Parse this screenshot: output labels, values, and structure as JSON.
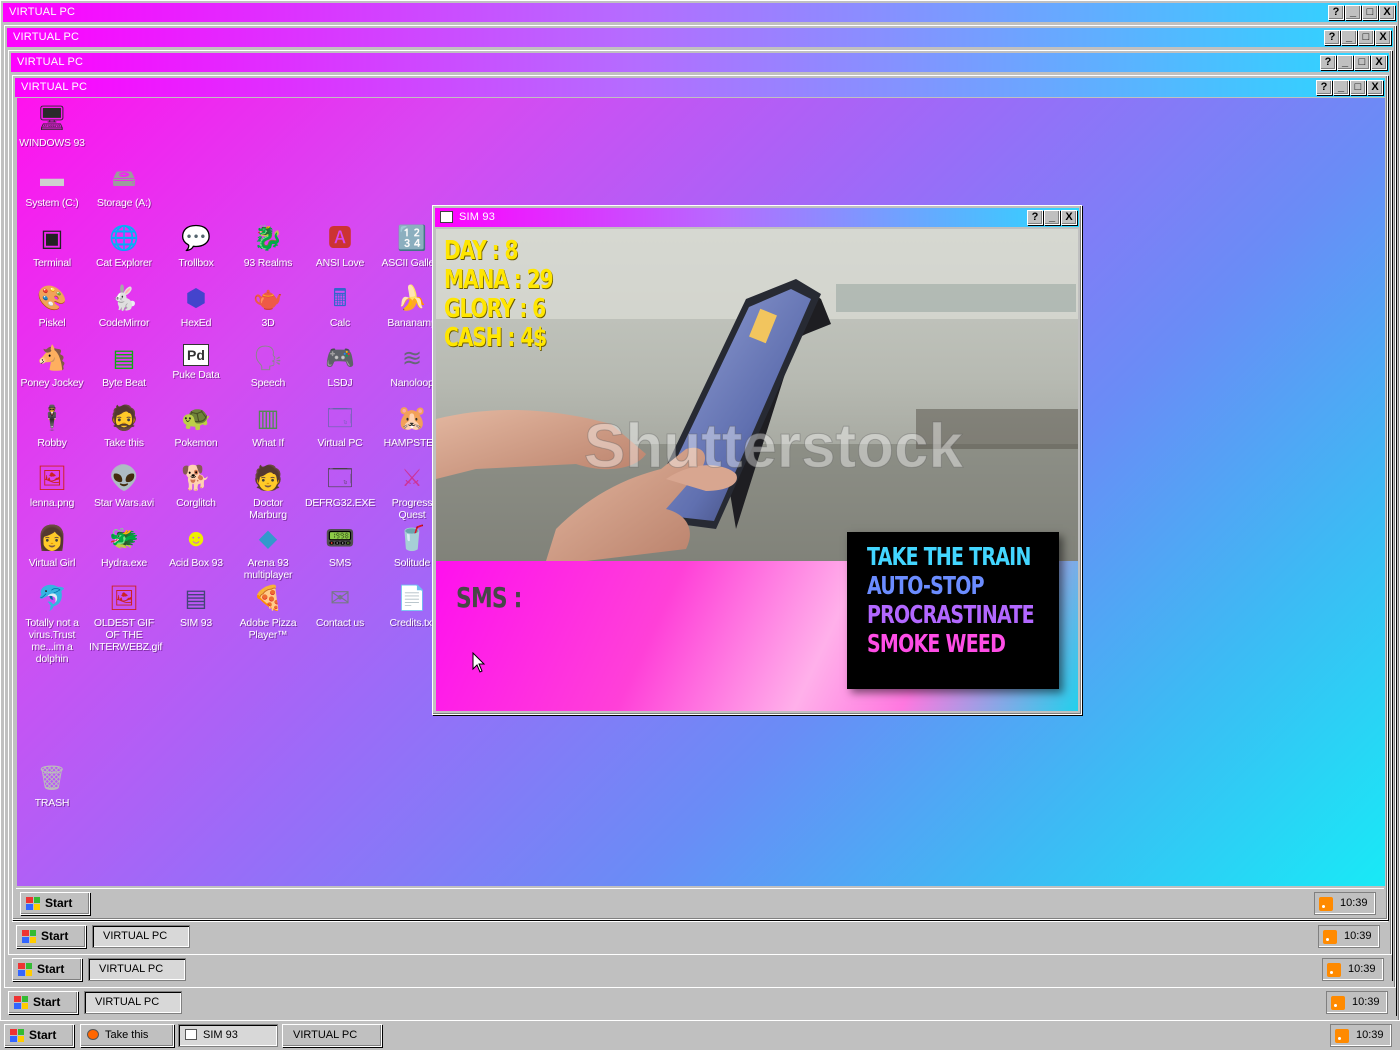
{
  "window_title": "VIRTUAL PC",
  "title_buttons": [
    "?",
    "_",
    "□",
    "X"
  ],
  "colors": {
    "title_gradient": [
      "#ff00ff",
      "#b56cff",
      "#2ad8ff"
    ],
    "stats": "#ffe600"
  },
  "desktop": {
    "icons": [
      {
        "label": "WINDOWS 93",
        "icon": "computer-icon",
        "glyph": "🖥"
      },
      {
        "label": "System (C:)",
        "icon": "hard-drive-icon",
        "glyph": "▬"
      },
      {
        "label": "Storage (A:)",
        "icon": "floppy-drive-icon",
        "glyph": "🖴"
      },
      {
        "label": "Terminal",
        "icon": "terminal-icon",
        "glyph": "▣"
      },
      {
        "label": "Cat Explorer",
        "icon": "globe-cat-icon",
        "glyph": "🌐"
      },
      {
        "label": "Trollbox",
        "icon": "trollbox-icon",
        "glyph": "💬"
      },
      {
        "label": "93 Realms",
        "icon": "dragon-icon",
        "glyph": "🐉"
      },
      {
        "label": "ANSI Love",
        "icon": "ansi-icon",
        "glyph": "🅰"
      },
      {
        "label": "ASCII Gallery",
        "icon": "ascii-gallery-icon",
        "glyph": "🔢"
      },
      {
        "label": "Piskel",
        "icon": "palette-icon",
        "glyph": "🎨"
      },
      {
        "label": "CodeMirror",
        "icon": "codemirror-icon",
        "glyph": "🐇"
      },
      {
        "label": "HexEd",
        "icon": "hex-cube-icon",
        "glyph": "⬢"
      },
      {
        "label": "3D",
        "icon": "teapot-icon",
        "glyph": "🫖"
      },
      {
        "label": "Calc",
        "icon": "calculator-icon",
        "glyph": "🖩"
      },
      {
        "label": "Bananamp",
        "icon": "banana-icon",
        "glyph": "🍌"
      },
      {
        "label": "Poney Jockey",
        "icon": "pony-icon",
        "glyph": "🐴"
      },
      {
        "label": "Byte Beat",
        "icon": "bytebeat-icon",
        "glyph": "▤"
      },
      {
        "label": "Puke Data",
        "icon": "puke-data-icon",
        "glyph": "Pd"
      },
      {
        "label": "Speech",
        "icon": "speech-icon",
        "glyph": "🗣"
      },
      {
        "label": "LSDJ",
        "icon": "gameboy-icon",
        "glyph": "🎮"
      },
      {
        "label": "Nanoloop",
        "icon": "nanoloop-icon",
        "glyph": "≋"
      },
      {
        "label": "Robby",
        "icon": "robby-icon",
        "glyph": "🕴"
      },
      {
        "label": "Take this",
        "icon": "take-this-icon",
        "glyph": "🧔"
      },
      {
        "label": "Pokemon",
        "icon": "pokemon-icon",
        "glyph": "🐢"
      },
      {
        "label": "What If",
        "icon": "what-if-icon",
        "glyph": "▥"
      },
      {
        "label": "Virtual PC",
        "icon": "virtual-pc-icon",
        "glyph": "🗔"
      },
      {
        "label": "HAMPSTER",
        "icon": "hamster-icon",
        "glyph": "🐹"
      },
      {
        "label": "lenna.png",
        "icon": "image-file-icon",
        "glyph": "🖼"
      },
      {
        "label": "Star Wars.avi",
        "icon": "yoda-icon",
        "glyph": "👽"
      },
      {
        "label": "Corglitch",
        "icon": "corgi-icon",
        "glyph": "🐕"
      },
      {
        "label": "Doctor Marburg",
        "icon": "doctor-icon",
        "glyph": "🧑"
      },
      {
        "label": "DEFRG32.EXE",
        "icon": "defrag-icon",
        "glyph": "🗔"
      },
      {
        "label": "Progress Quest",
        "icon": "progress-quest-icon",
        "glyph": "⚔"
      },
      {
        "label": "Virtual Girl",
        "icon": "virtual-girl-icon",
        "glyph": "👩"
      },
      {
        "label": "Hydra.exe",
        "icon": "hydra-icon",
        "glyph": "🐲"
      },
      {
        "label": "Acid Box 93",
        "icon": "smiley-icon",
        "glyph": "☻"
      },
      {
        "label": "Arena 93 multiplayer",
        "icon": "cube-icon",
        "glyph": "◆"
      },
      {
        "label": "SMS",
        "icon": "sms-icon",
        "glyph": "📟"
      },
      {
        "label": "Solitude",
        "icon": "solitude-icon",
        "glyph": "🥤"
      },
      {
        "label": "Totally not a virus.Trust me...im a dolphin",
        "icon": "dolphin-icon",
        "glyph": "🐬"
      },
      {
        "label": "OLDEST GIF OF THE INTERWEBZ.gif",
        "icon": "gif-file-icon",
        "glyph": "🖼"
      },
      {
        "label": "SIM 93",
        "icon": "sim93-icon",
        "glyph": "▤"
      },
      {
        "label": "Adobe Pizza Player™",
        "icon": "pizza-icon",
        "glyph": "🍕"
      },
      {
        "label": "Contact us",
        "icon": "contact-icon",
        "glyph": "✉"
      },
      {
        "label": "Credits.txt",
        "icon": "text-file-icon",
        "glyph": "📄"
      },
      {
        "label": "TRASH",
        "icon": "trash-icon",
        "glyph": "🗑"
      }
    ]
  },
  "sim93": {
    "title": "SIM 93",
    "stats": [
      "DAY : 8",
      "MANA : 29",
      "GLORY : 6",
      "CASH : 4$"
    ],
    "watermark": "Shutterstock",
    "sms_label": "SMS :",
    "choices": [
      {
        "label": "TAKE THE TRAIN",
        "color": "#43d6ff"
      },
      {
        "label": "AUTO-STOP",
        "color": "#6b8cff"
      },
      {
        "label": "PROCRASTINATE",
        "color": "#b267ff"
      },
      {
        "label": "SMOKE WEED",
        "color": "#ff4de6"
      }
    ]
  },
  "taskbars": [
    {
      "start": "Start",
      "tasks": [],
      "time": "10:39"
    },
    {
      "start": "Start",
      "tasks": [
        "VIRTUAL PC"
      ],
      "time": "10:39"
    },
    {
      "start": "Start",
      "tasks": [
        "VIRTUAL PC"
      ],
      "time": "10:39"
    },
    {
      "start": "Start",
      "tasks": [
        "VIRTUAL PC"
      ],
      "time": "10:39"
    },
    {
      "start": "Start",
      "tasks": [
        "Take this",
        "SIM 93",
        "VIRTUAL PC"
      ],
      "time": "10:39"
    }
  ]
}
